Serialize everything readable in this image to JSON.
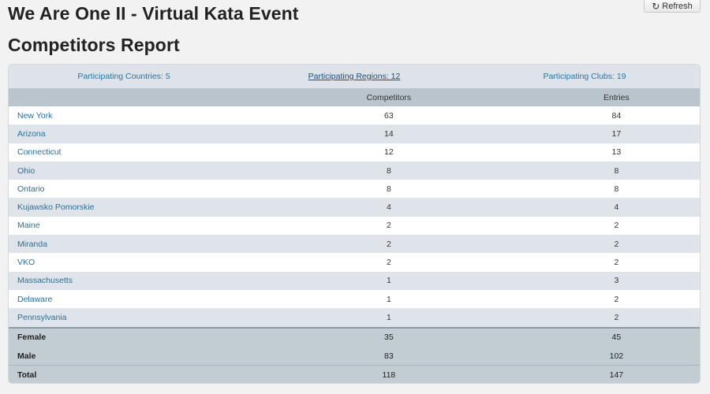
{
  "header": {
    "title": "We Are One II - Virtual Kata Event",
    "subtitle": "Competitors Report",
    "refresh_label": "Refresh",
    "refresh_icon": "refresh-icon"
  },
  "summary": {
    "countries": "Participating Countries: 5",
    "regions": "Participating Regions: 12",
    "clubs": "Participating Clubs: 19"
  },
  "table": {
    "columns": [
      "",
      "Competitors",
      "Entries"
    ],
    "rows": [
      {
        "name": "New York",
        "competitors": "63",
        "entries": "84"
      },
      {
        "name": "Arizona",
        "competitors": "14",
        "entries": "17"
      },
      {
        "name": "Connecticut",
        "competitors": "12",
        "entries": "13"
      },
      {
        "name": "Ohio",
        "competitors": "8",
        "entries": "8"
      },
      {
        "name": "Ontario",
        "competitors": "8",
        "entries": "8"
      },
      {
        "name": "Kujawsko Pomorskie",
        "competitors": "4",
        "entries": "4"
      },
      {
        "name": "Maine",
        "competitors": "2",
        "entries": "2"
      },
      {
        "name": "Miranda",
        "competitors": "2",
        "entries": "2"
      },
      {
        "name": "VKO",
        "competitors": "2",
        "entries": "2"
      },
      {
        "name": "Massachusetts",
        "competitors": "1",
        "entries": "3"
      },
      {
        "name": "Delaware",
        "competitors": "1",
        "entries": "2"
      },
      {
        "name": "Pennsylvania",
        "competitors": "1",
        "entries": "2"
      }
    ],
    "totals": [
      {
        "name": "Female",
        "competitors": "35",
        "entries": "45"
      },
      {
        "name": "Male",
        "competitors": "83",
        "entries": "102"
      },
      {
        "name": "Total",
        "competitors": "118",
        "entries": "147"
      }
    ]
  }
}
